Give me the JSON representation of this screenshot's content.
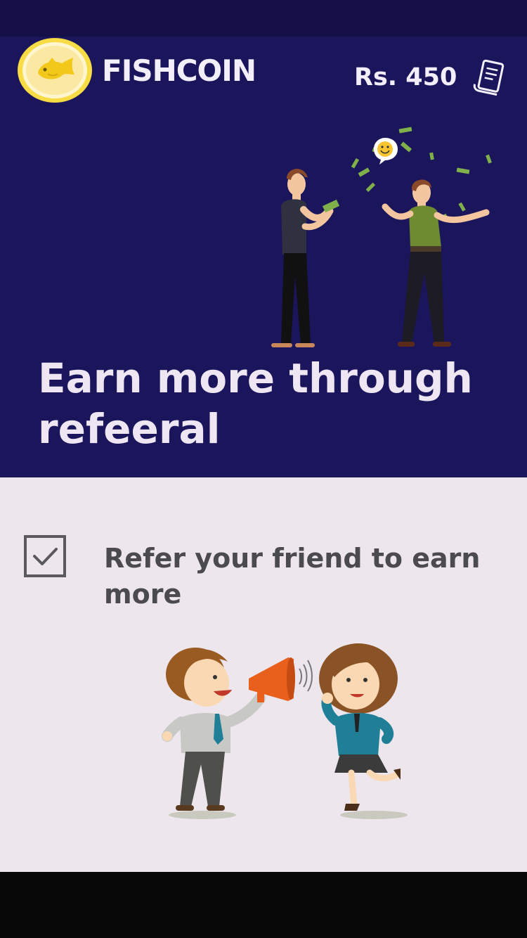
{
  "header": {
    "brand": "FISHCOIN",
    "balance": "Rs. 450",
    "logo_icon": "gold-fish-coin-icon",
    "receipt_icon": "receipt-icon"
  },
  "hero": {
    "headline": "Earn more through refeeral",
    "illustration": "friends-sharing-money-illustration"
  },
  "refer": {
    "text": "Refer your friend to earn more",
    "checkbox_checked": true,
    "illustration": "megaphone-referral-illustration"
  },
  "colors": {
    "status_bar": "#141047",
    "hero_bg": "#1b155c",
    "content_bg": "#ede7ed",
    "headline_text": "#eee6f2",
    "body_text": "#4b4a4d",
    "coin_gold": "#f4d03f",
    "bottom_bar": "#080808"
  }
}
